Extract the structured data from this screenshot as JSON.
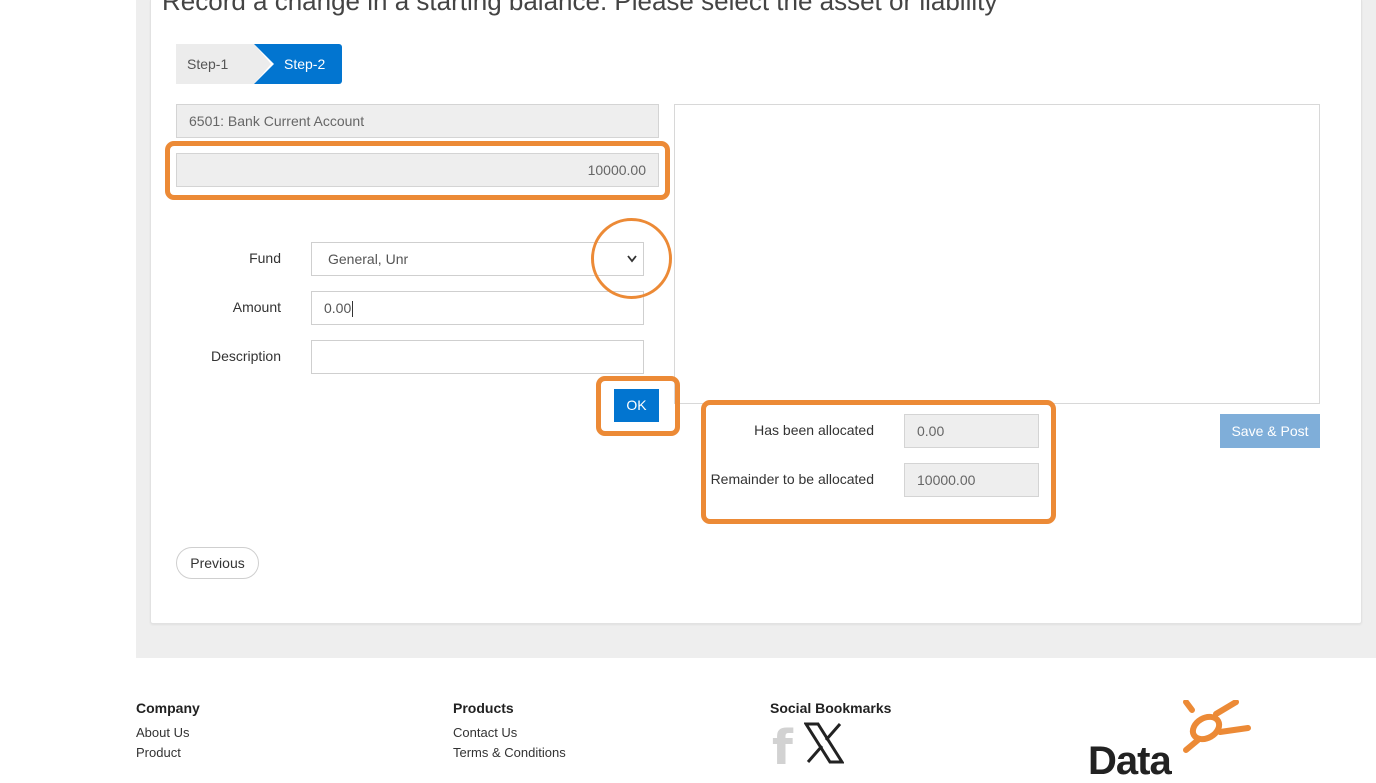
{
  "header": {
    "title": "Record a change in a starting balance. Please select the asset or liability"
  },
  "steps": [
    {
      "label": "Step-1",
      "active": false
    },
    {
      "label": "Step-2",
      "active": true
    }
  ],
  "form": {
    "account": "6501: Bank Current Account",
    "amount_total": "10000.00",
    "fund_label": "Fund",
    "fund_selected": "General, Unr",
    "amount_label": "Amount",
    "amount_value": "0.00",
    "description_label": "Description",
    "description_value": "",
    "ok_label": "OK"
  },
  "allocation": {
    "allocated_label": "Has been allocated",
    "allocated_value": "0.00",
    "remainder_label": "Remainder to be allocated",
    "remainder_value": "10000.00"
  },
  "actions": {
    "save_post_label": "Save & Post",
    "previous_label": "Previous"
  },
  "footer": {
    "company_title": "Company",
    "company_links": [
      "About Us",
      "Product"
    ],
    "products_title": "Products",
    "products_links": [
      "Contact Us",
      "Terms & Conditions"
    ],
    "social_title": "Social Bookmarks",
    "logo_text": "Data"
  },
  "colors": {
    "primary": "#0275d0",
    "highlight": "#ec8a36",
    "disabled_button": "#7faed9"
  },
  "icons": {
    "facebook": "facebook-icon",
    "x": "x-twitter-icon",
    "dropdown": "chevron-down-icon"
  }
}
